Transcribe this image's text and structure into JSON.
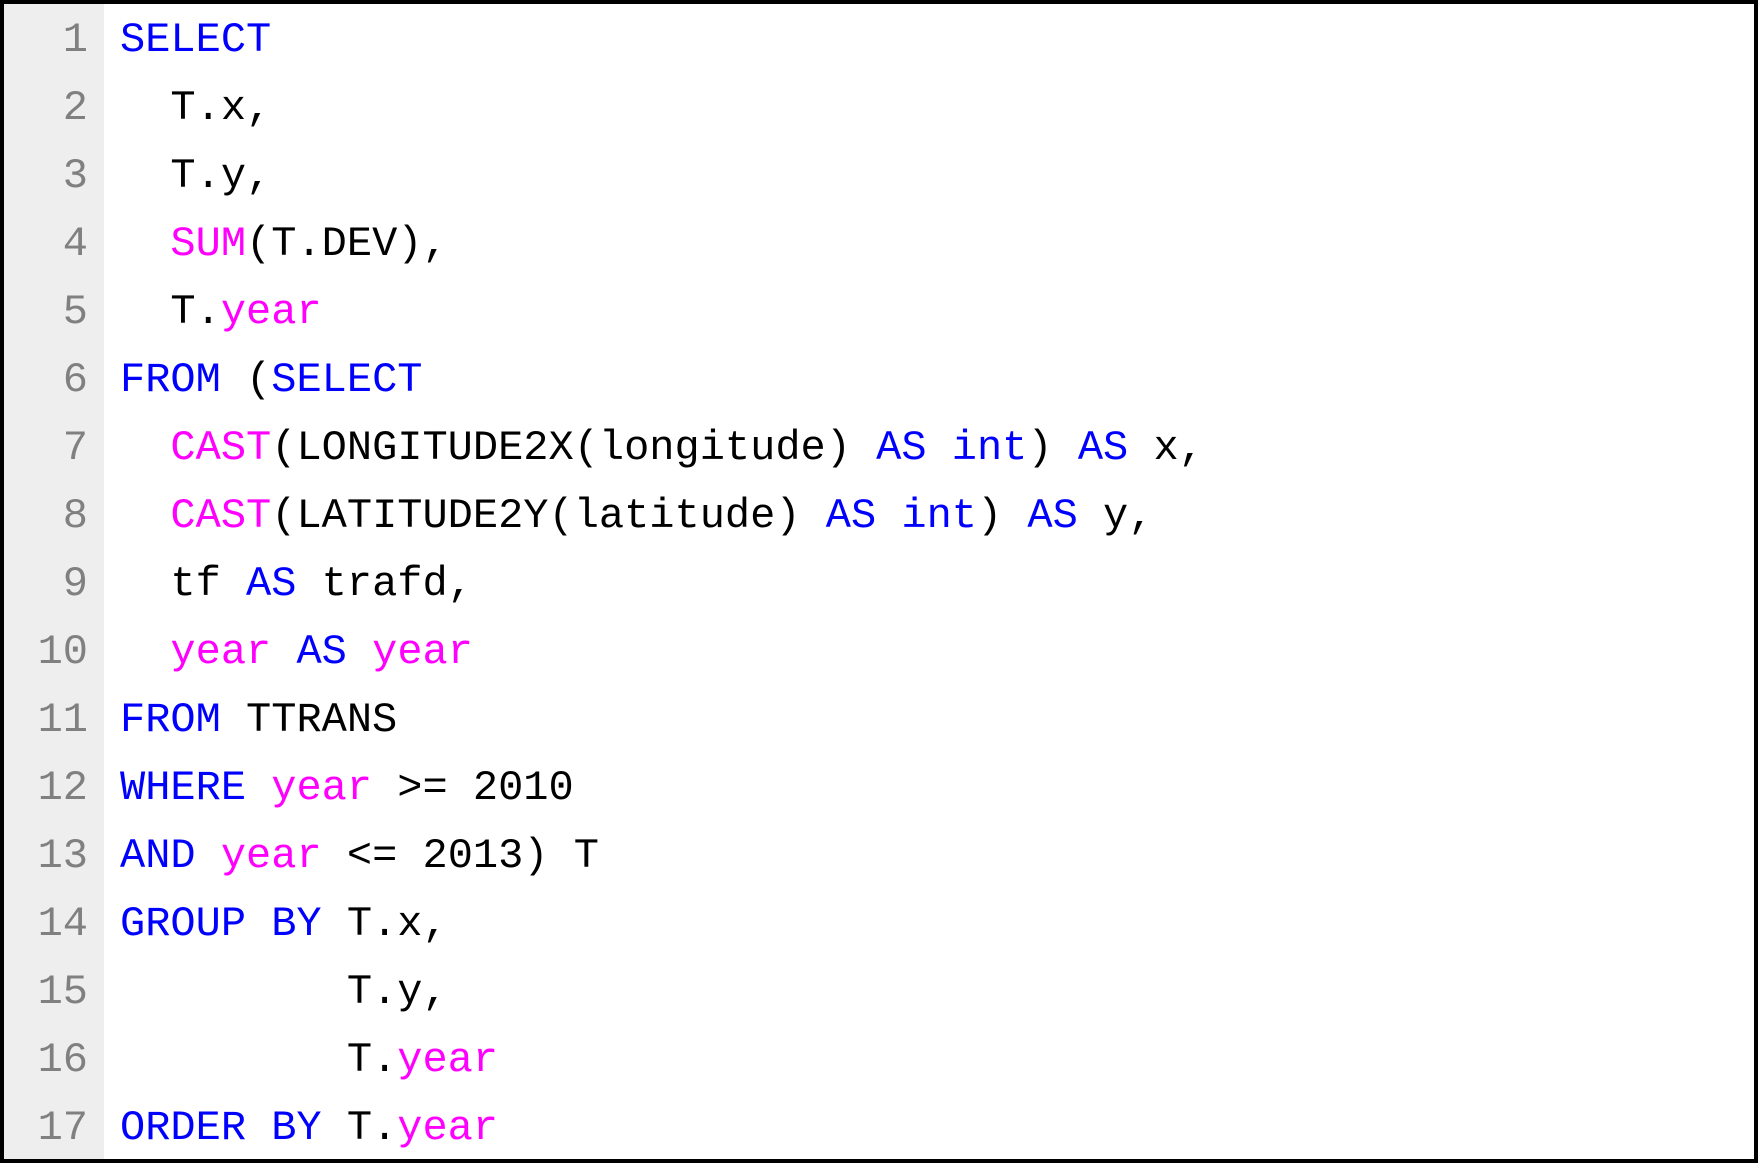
{
  "editor": {
    "lines": [
      {
        "number": "1",
        "tokens": [
          {
            "cls": "tok-keyword",
            "text": "SELECT"
          }
        ]
      },
      {
        "number": "2",
        "tokens": [
          {
            "cls": "tok-plain",
            "text": "  T.x,"
          }
        ]
      },
      {
        "number": "3",
        "tokens": [
          {
            "cls": "tok-plain",
            "text": "  T.y,"
          }
        ]
      },
      {
        "number": "4",
        "tokens": [
          {
            "cls": "tok-plain",
            "text": "  "
          },
          {
            "cls": "tok-func",
            "text": "SUM"
          },
          {
            "cls": "tok-plain",
            "text": "(T.DEV),"
          }
        ]
      },
      {
        "number": "5",
        "tokens": [
          {
            "cls": "tok-plain",
            "text": "  T."
          },
          {
            "cls": "tok-func",
            "text": "year"
          }
        ]
      },
      {
        "number": "6",
        "tokens": [
          {
            "cls": "tok-keyword",
            "text": "FROM"
          },
          {
            "cls": "tok-plain",
            "text": " ("
          },
          {
            "cls": "tok-keyword",
            "text": "SELECT"
          }
        ]
      },
      {
        "number": "7",
        "tokens": [
          {
            "cls": "tok-plain",
            "text": "  "
          },
          {
            "cls": "tok-func",
            "text": "CAST"
          },
          {
            "cls": "tok-plain",
            "text": "(LONGITUDE2X(longitude) "
          },
          {
            "cls": "tok-keyword",
            "text": "AS int"
          },
          {
            "cls": "tok-plain",
            "text": ") "
          },
          {
            "cls": "tok-keyword",
            "text": "AS"
          },
          {
            "cls": "tok-plain",
            "text": " x,"
          }
        ]
      },
      {
        "number": "8",
        "tokens": [
          {
            "cls": "tok-plain",
            "text": "  "
          },
          {
            "cls": "tok-func",
            "text": "CAST"
          },
          {
            "cls": "tok-plain",
            "text": "(LATITUDE2Y(latitude) "
          },
          {
            "cls": "tok-keyword",
            "text": "AS int"
          },
          {
            "cls": "tok-plain",
            "text": ") "
          },
          {
            "cls": "tok-keyword",
            "text": "AS"
          },
          {
            "cls": "tok-plain",
            "text": " y,"
          }
        ]
      },
      {
        "number": "9",
        "tokens": [
          {
            "cls": "tok-plain",
            "text": "  tf "
          },
          {
            "cls": "tok-keyword",
            "text": "AS"
          },
          {
            "cls": "tok-plain",
            "text": " trafd,"
          }
        ]
      },
      {
        "number": "10",
        "tokens": [
          {
            "cls": "tok-plain",
            "text": "  "
          },
          {
            "cls": "tok-func",
            "text": "year"
          },
          {
            "cls": "tok-plain",
            "text": " "
          },
          {
            "cls": "tok-keyword",
            "text": "AS"
          },
          {
            "cls": "tok-plain",
            "text": " "
          },
          {
            "cls": "tok-func",
            "text": "year"
          }
        ]
      },
      {
        "number": "11",
        "tokens": [
          {
            "cls": "tok-keyword",
            "text": "FROM"
          },
          {
            "cls": "tok-plain",
            "text": " TTRANS"
          }
        ]
      },
      {
        "number": "12",
        "tokens": [
          {
            "cls": "tok-keyword",
            "text": "WHERE"
          },
          {
            "cls": "tok-plain",
            "text": " "
          },
          {
            "cls": "tok-func",
            "text": "year"
          },
          {
            "cls": "tok-plain",
            "text": " >= 2010"
          }
        ]
      },
      {
        "number": "13",
        "tokens": [
          {
            "cls": "tok-keyword",
            "text": "AND"
          },
          {
            "cls": "tok-plain",
            "text": " "
          },
          {
            "cls": "tok-func",
            "text": "year"
          },
          {
            "cls": "tok-plain",
            "text": " <= 2013) T"
          }
        ]
      },
      {
        "number": "14",
        "tokens": [
          {
            "cls": "tok-keyword",
            "text": "GROUP BY"
          },
          {
            "cls": "tok-plain",
            "text": " T.x,"
          }
        ]
      },
      {
        "number": "15",
        "tokens": [
          {
            "cls": "tok-plain",
            "text": "         T.y,"
          }
        ]
      },
      {
        "number": "16",
        "tokens": [
          {
            "cls": "tok-plain",
            "text": "         T."
          },
          {
            "cls": "tok-func",
            "text": "year"
          }
        ]
      },
      {
        "number": "17",
        "tokens": [
          {
            "cls": "tok-keyword",
            "text": "ORDER BY"
          },
          {
            "cls": "tok-plain",
            "text": " T."
          },
          {
            "cls": "tok-func",
            "text": "year"
          }
        ]
      }
    ]
  }
}
